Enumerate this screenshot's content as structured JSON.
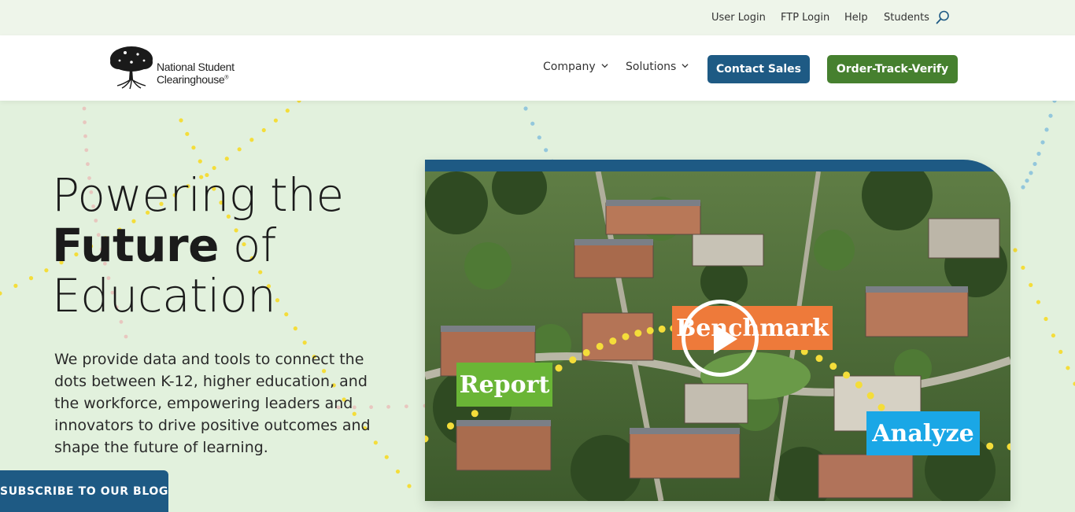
{
  "utility_nav": {
    "links": [
      "User Login",
      "FTP Login",
      "Help",
      "Students"
    ],
    "search_icon": "search-icon"
  },
  "header": {
    "logo": {
      "line1": "National Student",
      "line2": "Clearinghouse",
      "mark": "®",
      "icon": "tree-icon"
    },
    "nav": [
      {
        "label": "Company",
        "icon": "chevron-down-icon"
      },
      {
        "label": "Solutions",
        "icon": "chevron-down-icon"
      }
    ],
    "contact_label": "Contact Sales",
    "order_label": "Order-Track-Verify"
  },
  "hero": {
    "title_line1": "Powering the",
    "title_bold": "Future",
    "title_of": " of",
    "title_line3": "Education",
    "description": "We provide data and tools to connect the dots between K-12, higher education, and the workforce, empowering leaders and innovators to drive positive outcomes and shape the future of learning."
  },
  "video": {
    "labels": {
      "report": "Report",
      "benchmark": "Benchmark",
      "analyze": "Analyze"
    },
    "play_icon": "play-icon"
  },
  "subscribe_label": "SUBSCRIBE TO OUR BLOG",
  "colors": {
    "page_bg": "#e2f1dd",
    "brand_blue": "#1e5a84",
    "brand_green": "#46802f",
    "report_green": "#6ab536",
    "benchmark_orange": "#ee7a3a",
    "analyze_blue": "#1aa7e6",
    "dot_yellow": "#f4dd3a"
  }
}
